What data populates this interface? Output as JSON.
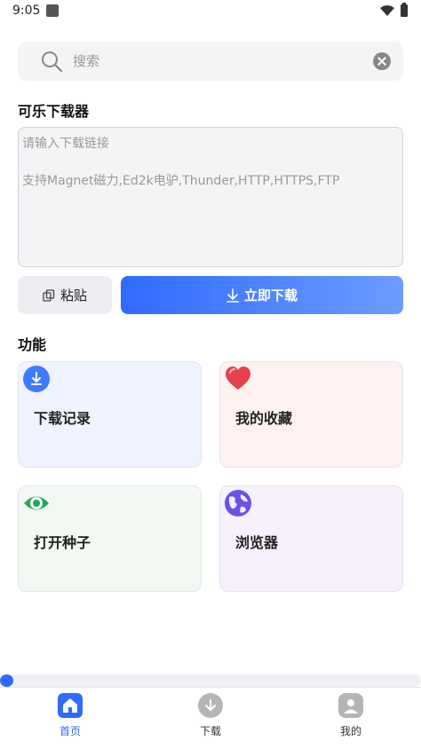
{
  "status_bar": {
    "time": "9:05"
  },
  "search": {
    "placeholder": "搜索"
  },
  "app_title": "可乐下载器",
  "link_input": {
    "placeholder": "请输入下载链接\n\n支持Magnet磁力,Ed2k电驴,Thunder,HTTP,HTTPS,FTP"
  },
  "actions": {
    "paste_label": "粘贴",
    "download_label": "立即下载"
  },
  "features": {
    "title": "功能",
    "items": [
      {
        "label": "下载记录",
        "icon": "download-icon",
        "bg": "#eef3ff",
        "icon_color": "#3d7bff"
      },
      {
        "label": "我的收藏",
        "icon": "heart-icon",
        "bg": "#fdf2f0",
        "icon_color": "#e8414b"
      },
      {
        "label": "打开种子",
        "icon": "eye-icon",
        "bg": "#f3f8f2",
        "icon_color": "#1fa65a"
      },
      {
        "label": "浏览器",
        "icon": "globe-icon",
        "bg": "#f6f1fd",
        "icon_color": "#6b52e6"
      }
    ]
  },
  "nav": {
    "items": [
      {
        "label": "首页",
        "icon": "home-icon",
        "active": true
      },
      {
        "label": "下载",
        "icon": "download-circle-icon",
        "active": false
      },
      {
        "label": "我的",
        "icon": "user-icon",
        "active": false
      }
    ]
  },
  "colors": {
    "accent": "#2f6bff",
    "nav_active": "#2f6bff",
    "nav_inactive": "#b5b5b5"
  }
}
